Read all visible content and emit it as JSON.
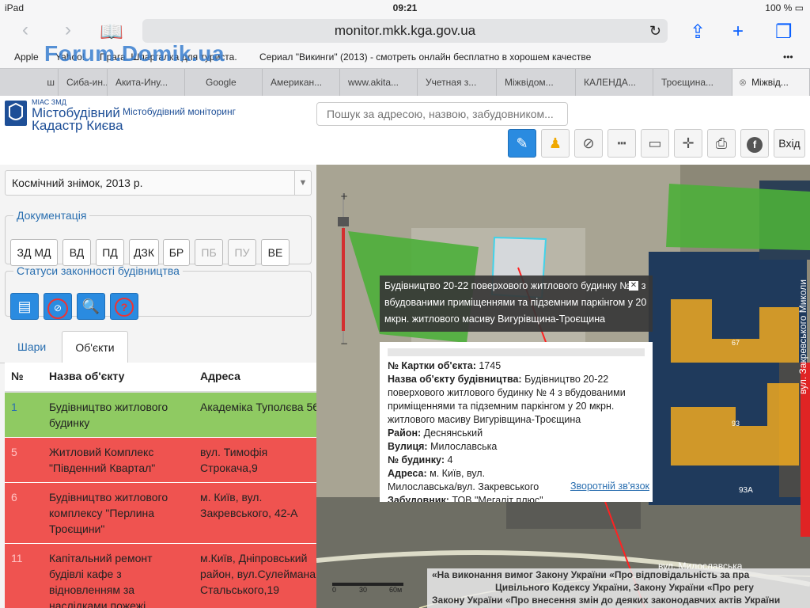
{
  "statusbar": {
    "device": "iPad",
    "time": "09:21",
    "battery": "100 %"
  },
  "browser": {
    "url": "monitor.mkk.kga.gov.ua",
    "watermark": "Forum.Domik.ua",
    "bookmarks": [
      "Apple",
      "Yahoo!",
      "Прага. Шпаргалка для туриста.",
      "Сериал \"Викинги\" (2013) - смотреть онлайн бесплатно в хорошем качестве"
    ],
    "tabs": [
      "ш",
      "Сиба-ин...",
      "Акита-Ину...",
      "Google",
      "Американ...",
      "www.akita...",
      "Учетная з...",
      "Міжвідом...",
      "КАЛЕНДА...",
      "Троєщина...",
      "Міжвід..."
    ]
  },
  "header": {
    "logo_small": "МІАС ЗМД",
    "logo_line1": "Містобудівний",
    "logo_line2": "Кадастр Києва",
    "subtitle": "Містобудівний моніторинг",
    "search_placeholder": "Пошук за адресою, назвою, забудовником...",
    "exit_label": "Вхід",
    "tools": [
      "pencil-icon",
      "person-icon",
      "compass-icon",
      "ruler-icon",
      "measure-area-icon",
      "pan-icon",
      "printer-icon",
      "facebook-icon"
    ]
  },
  "panel": {
    "layer": "Космічний знімок, 2013 р.",
    "doc_legend": "Документація",
    "doc_buttons": [
      {
        "label": "ЗД МД",
        "enabled": true
      },
      {
        "label": "ВД",
        "enabled": true
      },
      {
        "label": "ПД",
        "enabled": true
      },
      {
        "label": "ДЗК",
        "enabled": true
      },
      {
        "label": "БР",
        "enabled": true
      },
      {
        "label": "ПБ",
        "enabled": false
      },
      {
        "label": "ПУ",
        "enabled": false
      },
      {
        "label": "ВЕ",
        "enabled": true
      }
    ],
    "status_legend": "Статуси законності будівництва",
    "tab_layers": "Шари",
    "tab_objects": "Об'єкти",
    "col_num": "№",
    "col_name": "Назва об'єкту",
    "col_addr": "Адреса",
    "rows": [
      {
        "num": "1",
        "name": "Будівництво житлового будинку",
        "addr": "Академіка Туполєва 56",
        "color": "#8fca62"
      },
      {
        "num": "5",
        "name": "Житловий Комплекс \"Південний Квартал\"",
        "addr": "вул. Тимофія Строкача,9",
        "color": "#ef5350"
      },
      {
        "num": "6",
        "name": "Будівництво житлового комплексу \"Перлина Троєщини\"",
        "addr": "м. Київ, вул. Закревського, 42-А",
        "color": "#ef5350"
      },
      {
        "num": "11",
        "name": "Капітальний ремонт будівлі кафе з відновленням за наслідками пожежі",
        "addr": "м.Київ, Дніпровський район, вул.Сулеймана Стальського,19",
        "color": "#ef5350"
      }
    ]
  },
  "map": {
    "popup_title": "Будівництво 20-22 поверхового житлового будинку № 4 з вбудованими приміщеннями та підземним паркінгом у 20 мкрн. житлового масиву Вигурівщина-Троєщина",
    "fields": [
      {
        "k": "№ Картки об'єкта:",
        "v": "1745"
      },
      {
        "k": "Назва об'єкту будівництва:",
        "v": "Будівництво 20-22 поверхового житлового будинку № 4 з вбудованими приміщеннями та підземним паркінгом у 20 мкрн. житлового масиву Вигурівщина-Троєщина"
      },
      {
        "k": "Район:",
        "v": "Деснянський"
      },
      {
        "k": "Вулиця:",
        "v": "Милославська"
      },
      {
        "k": "№ будинку:",
        "v": "4"
      },
      {
        "k": "Адреса:",
        "v": "м. Київ, вул. Милославська/вул. Закревського"
      },
      {
        "k": "Забудовник:",
        "v": "ТОВ \"Мегаліт плюс\""
      }
    ],
    "feedback": "Зворотній зв'язок",
    "street_label": "вул. Закревського Миколи",
    "street_label2": "вул. Милославська",
    "building_label1": "67",
    "building_label2": "93",
    "building_label3": "93А",
    "scale_labels": [
      "0",
      "30",
      "60м"
    ],
    "legal_line1": "«На виконання вимог Закону України «Про відповідальність за пра",
    "legal_line2": "Цивільного Кодексу України, Закону України «Про регу",
    "legal_line3": "Закону України «Про внесення змін до деяких законодавчих актів України"
  }
}
